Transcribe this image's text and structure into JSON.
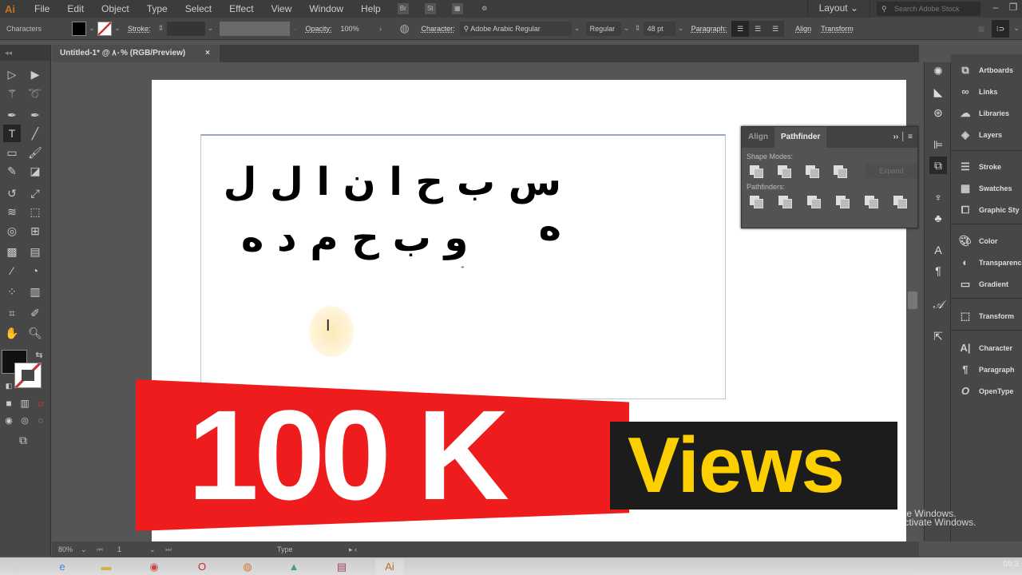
{
  "app": {
    "logo": "Ai"
  },
  "menu": [
    "File",
    "Edit",
    "Object",
    "Type",
    "Select",
    "Effect",
    "View",
    "Window",
    "Help"
  ],
  "menu_icons": {
    "bridge": "Br",
    "stock": "St"
  },
  "workspace": {
    "label": "Layout",
    "search_placeholder": "Search Adobe Stock"
  },
  "control_bar": {
    "context_label": "Characters",
    "stroke_label": "Stroke:",
    "opacity_label": "Opacity:",
    "opacity_value": "100%",
    "character_label": "Character:",
    "font_family": "Adobe Arabic Regular",
    "font_style": "Regular",
    "font_size": "48 pt",
    "paragraph_label": "Paragraph:",
    "align_link": "Align",
    "transform_link": "Transform",
    "fill_color": "#000000"
  },
  "document_tab": {
    "title": "Untitled-1* @ ٨٠% (RGB/Preview)",
    "close": "×"
  },
  "artboard": {
    "line1": "س ب ح ا ن ا ل ل ه",
    "line2": "و ب ح م د ه"
  },
  "pathfinder_panel": {
    "tabs": [
      "Align",
      "Pathfinder"
    ],
    "active_tab": "Pathfinder",
    "shape_modes_label": "Shape Modes:",
    "pathfinders_label": "Pathfinders:",
    "expand_label": "Expand"
  },
  "panels": [
    {
      "label": "Artboards",
      "icon": "artboards-icon"
    },
    {
      "label": "Links",
      "icon": "links-icon"
    },
    {
      "label": "Libraries",
      "icon": "libraries-icon"
    },
    {
      "label": "Layers",
      "icon": "layers-icon"
    },
    {
      "label": "Stroke",
      "icon": "stroke-icon"
    },
    {
      "label": "Swatches",
      "icon": "swatches-icon"
    },
    {
      "label": "Graphic Sty",
      "icon": "graphic-styles-icon"
    },
    {
      "label": "Color",
      "icon": "color-icon"
    },
    {
      "label": "Transparenc",
      "icon": "transparency-icon"
    },
    {
      "label": "Gradient",
      "icon": "gradient-icon"
    },
    {
      "label": "Transform",
      "icon": "transform-icon"
    },
    {
      "label": "Character",
      "icon": "character-icon"
    },
    {
      "label": "Paragraph",
      "icon": "paragraph-icon"
    },
    {
      "label": "OpenType",
      "icon": "opentype-icon"
    }
  ],
  "status_bar": {
    "zoom": "80%",
    "artboard_num": "1",
    "tool_name": "Type"
  },
  "overlay": {
    "big_number": "100 K",
    "views": "Views",
    "red": "#ee1c1c",
    "yellow": "#fcd000"
  },
  "watermark": {
    "line1": "Go to PC settings to activate Windows.",
    "line2": "Go to PC settings to activate Windows."
  },
  "taskbar": {
    "clock": "09:3"
  }
}
